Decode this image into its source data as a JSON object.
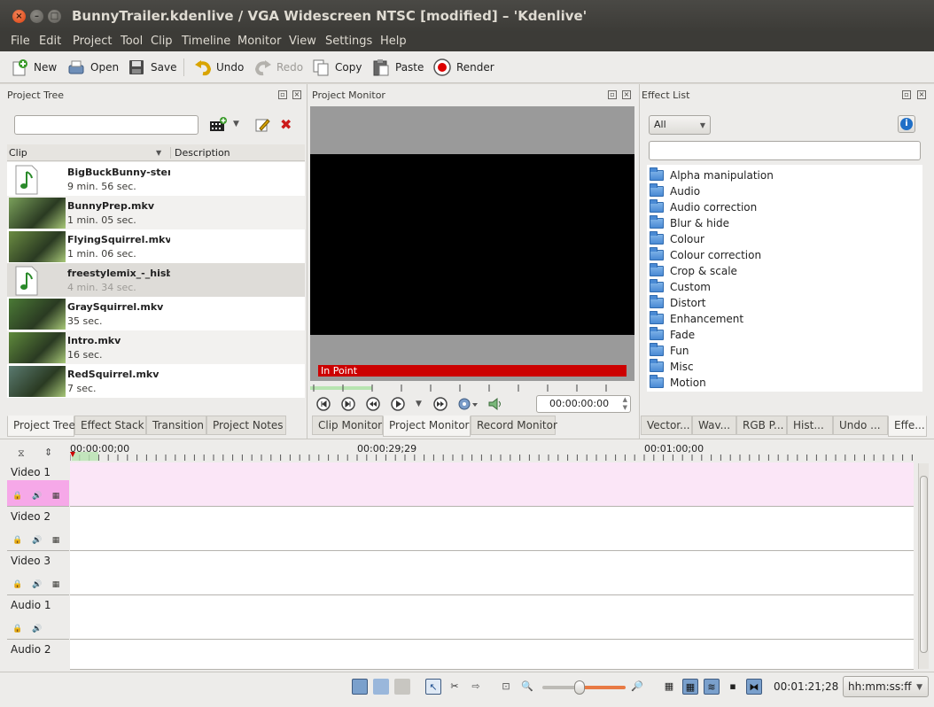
{
  "window": {
    "title": "BunnyTrailer.kdenlive / VGA Widescreen NTSC [modified] – 'Kdenlive'",
    "close_glyph": "×",
    "min_glyph": "–",
    "max_glyph": "□"
  },
  "menu": [
    "File",
    "Edit",
    "Project",
    "Tool",
    "Clip",
    "Timeline",
    "Monitor",
    "View",
    "Settings",
    "Help"
  ],
  "toolbar": {
    "new": "New",
    "open": "Open",
    "save": "Save",
    "undo": "Undo",
    "redo": "Redo",
    "copy": "Copy",
    "paste": "Paste",
    "render": "Render"
  },
  "project_tree": {
    "title": "Project Tree",
    "search_value": "",
    "col_clip": "Clip",
    "col_description": "Description",
    "clips": [
      {
        "name": "BigBuckBunny-ster",
        "duration": "9 min. 56 sec.",
        "kind": "audio"
      },
      {
        "name": "BunnyPrep.mkv",
        "duration": "1 min. 05 sec.",
        "kind": "video"
      },
      {
        "name": "FlyingSquirrel.mkv",
        "duration": "1 min. 06 sec.",
        "kind": "video"
      },
      {
        "name": "freestylemix_-_hisb",
        "duration": "4 min. 34 sec.",
        "kind": "audio"
      },
      {
        "name": "GraySquirrel.mkv",
        "duration": "35 sec.",
        "kind": "video"
      },
      {
        "name": "Intro.mkv",
        "duration": "16 sec.",
        "kind": "video"
      },
      {
        "name": "RedSquirrel.mkv",
        "duration": "7 sec.",
        "kind": "video"
      }
    ],
    "tabs": [
      "Project Tree",
      "Effect Stack",
      "Transition",
      "Project Notes"
    ]
  },
  "monitor": {
    "title": "Project Monitor",
    "in_point_label": "In Point",
    "timecode": "00:00:00:00",
    "tabs": [
      "Clip Monitor",
      "Project Monitor",
      "Record Monitor"
    ]
  },
  "effects": {
    "title": "Effect List",
    "filter": "All",
    "search_value": "",
    "items": [
      "Alpha manipulation",
      "Audio",
      "Audio correction",
      "Blur & hide",
      "Colour",
      "Colour correction",
      "Crop & scale",
      "Custom",
      "Distort",
      "Enhancement",
      "Fade",
      "Fun",
      "Misc",
      "Motion"
    ],
    "tabs": [
      "Vector...",
      "Wav...",
      "RGB P...",
      "Hist...",
      "Undo ...",
      "Effe..."
    ],
    "info_glyph": "i"
  },
  "timeline": {
    "ruler_labels": [
      "00:00:00;00",
      "00:00:29;29",
      "00:01:00;00"
    ],
    "tracks": [
      {
        "name": "Video 1",
        "type": "video"
      },
      {
        "name": "Video 2",
        "type": "video"
      },
      {
        "name": "Video 3",
        "type": "video"
      },
      {
        "name": "Audio 1",
        "type": "audio"
      },
      {
        "name": "Audio 2",
        "type": "audio"
      }
    ]
  },
  "statusbar": {
    "duration": "00:01:21;28",
    "timecode_format": "hh:mm:ss:ff"
  },
  "colors": {
    "titlebar": "#3c3b37",
    "in_point_bar": "#cc0000",
    "selected_track": "#fbe6f7",
    "folder": "#4a8ad4"
  }
}
